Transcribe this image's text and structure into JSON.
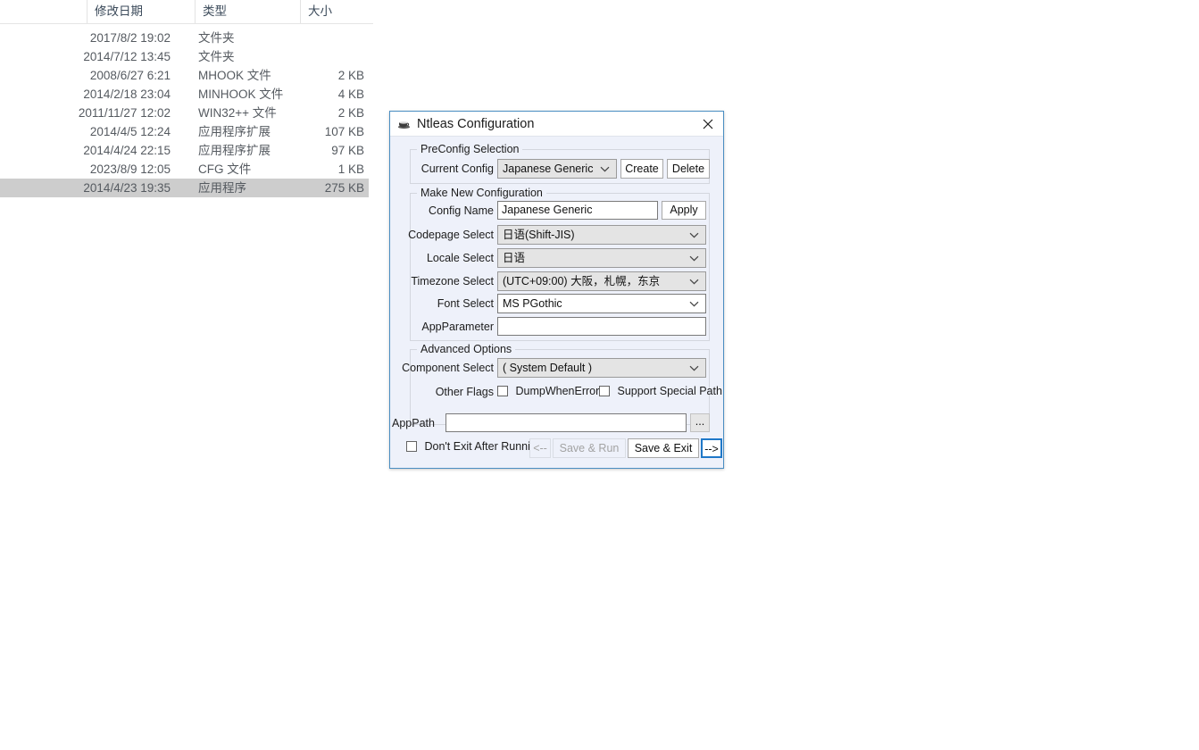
{
  "file_list": {
    "columns": [
      "修改日期",
      "类型",
      "大小"
    ],
    "rows": [
      {
        "date": "2017/8/2 19:02",
        "type": "文件夹",
        "size": "",
        "selected": false
      },
      {
        "date": "2014/7/12 13:45",
        "type": "文件夹",
        "size": "",
        "selected": false
      },
      {
        "date": "2008/6/27 6:21",
        "type": "MHOOK 文件",
        "size": "2 KB",
        "selected": false
      },
      {
        "date": "2014/2/18 23:04",
        "type": "MINHOOK 文件",
        "size": "4 KB",
        "selected": false
      },
      {
        "date": "2011/11/27 12:02",
        "type": "WIN32++ 文件",
        "size": "2 KB",
        "selected": false
      },
      {
        "date": "2014/4/5 12:24",
        "type": "应用程序扩展",
        "size": "107 KB",
        "selected": false
      },
      {
        "date": "2014/4/24 22:15",
        "type": "应用程序扩展",
        "size": "97 KB",
        "selected": false
      },
      {
        "date": "2023/8/9 12:05",
        "type": "CFG 文件",
        "size": "1 KB",
        "selected": false
      },
      {
        "date": "2014/4/23 19:35",
        "type": "应用程序",
        "size": "275 KB",
        "selected": true
      }
    ]
  },
  "dialog": {
    "title": "Ntleas Configuration",
    "icon": "coffee-cup-icon",
    "close_label": "✕",
    "accent_color": "#1f78c8",
    "background_color": "#eef1fa",
    "preconfig": {
      "group_label": "PreConfig Selection",
      "current_config_label": "Current Config",
      "current_config_value": "Japanese Generic",
      "create_label": "Create",
      "delete_label": "Delete"
    },
    "make_new": {
      "group_label": "Make New Configuration",
      "config_name_label": "Config Name",
      "config_name_value": "Japanese Generic",
      "apply_label": "Apply",
      "codepage_label": "Codepage Select",
      "codepage_value": "日语(Shift-JIS)",
      "locale_label": "Locale Select",
      "locale_value": "日语",
      "timezone_label": "Timezone Select",
      "timezone_value": "(UTC+09:00) 大阪，札幌，东京",
      "font_label": "Font Select",
      "font_value": "MS PGothic",
      "appparameter_label": "AppParameter",
      "appparameter_value": "",
      "appparameter_placeholder": ""
    },
    "advanced": {
      "group_label": "Advanced Options",
      "component_label": "Component Select",
      "component_value": "( System Default )",
      "other_flags_label": "Other Flags",
      "dump_when_error_label": "DumpWhenError",
      "dump_when_error_checked": false,
      "support_special_path_label": "Support Special Path",
      "support_special_path_checked": false
    },
    "footer": {
      "apppath_label": "AppPath",
      "apppath_value": "",
      "apppath_placeholder": "",
      "browse_label": "...",
      "dont_exit_label": "Don't Exit After Running",
      "dont_exit_checked": false,
      "prev_label": "<--",
      "save_run_label": "Save & Run",
      "save_exit_label": "Save & Exit",
      "next_label": "-->"
    }
  }
}
